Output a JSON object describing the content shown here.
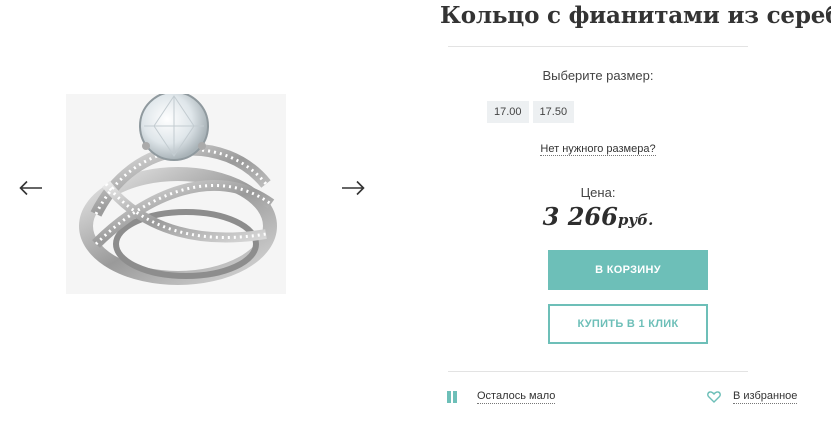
{
  "product": {
    "title": "Кольцо с фианитами из серебра"
  },
  "gallery": {
    "prev_icon": "arrow-left-icon",
    "next_icon": "arrow-right-icon",
    "image_alt": "ring-photo"
  },
  "size_selector": {
    "label": "Выберите размер:",
    "sizes": [
      "17.00",
      "17.50"
    ],
    "no_size_link": "Нет нужного размера?"
  },
  "price": {
    "label": "Цена:",
    "amount": "3 266",
    "currency": "руб."
  },
  "actions": {
    "cart_button": "В КОРЗИНУ",
    "one_click_button": "КУПИТЬ В 1 КЛИК"
  },
  "footer": {
    "stock_text": "Осталось мало",
    "favorite_text": "В избранное",
    "stock_icon": "stock-level-icon",
    "favorite_icon": "heart-icon"
  },
  "colors": {
    "accent": "#6dbfb8",
    "text": "#333333",
    "chip_bg": "#edf0f2"
  }
}
